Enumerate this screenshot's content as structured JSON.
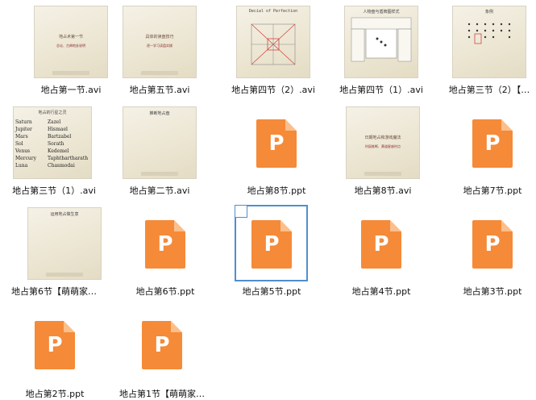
{
  "files": [
    {
      "name": "地占第一节.avi",
      "type": "video",
      "thumb_title": "地占术第一节",
      "thumb_sub": "总论、古典地卦说明"
    },
    {
      "name": "地占第五节.avi",
      "type": "video",
      "thumb_title": "具体的读盘技巧",
      "thumb_sub": "逐一学习读盘实操"
    },
    {
      "name": "地占第四节（2）.avi",
      "type": "video",
      "thumb_title": "Decial of Perfection",
      "thumb_sub": ""
    },
    {
      "name": "地占第四节（1）.avi",
      "type": "video",
      "thumb_title": "人物盘与盾牌图样式",
      "thumb_sub": ""
    },
    {
      "name": "地占第三节（2）【…",
      "type": "video",
      "thumb_title": "象例",
      "thumb_sub": ""
    },
    {
      "name": "地占第三节（1）.avi",
      "type": "video",
      "thumb_title": "地占的行星之灵",
      "thumb_sub": ""
    },
    {
      "name": "地占第二节.avi",
      "type": "video",
      "thumb_title": "推断地占盘",
      "thumb_sub": ""
    },
    {
      "name": "地占第8节.ppt",
      "type": "ppt"
    },
    {
      "name": "地占第8节.avi",
      "type": "video",
      "thumb_title": "日期地占和游戏魔法",
      "thumb_sub": "时辰推断、黄道星座时点"
    },
    {
      "name": "地占第7节.ppt",
      "type": "ppt"
    },
    {
      "name": "地占第6节【萌萌家…",
      "type": "video",
      "thumb_title": "运用地占做生意",
      "thumb_sub": ""
    },
    {
      "name": "地占第6节.ppt",
      "type": "ppt"
    },
    {
      "name": "地占第5节.ppt",
      "type": "ppt",
      "selected": true
    },
    {
      "name": "地占第4节.ppt",
      "type": "ppt"
    },
    {
      "name": "地占第3节.ppt",
      "type": "ppt"
    },
    {
      "name": "地占第2节.ppt",
      "type": "ppt"
    },
    {
      "name": "地占第1节【萌萌家…",
      "type": "ppt"
    }
  ],
  "thumb_texts": {
    "planets_left": [
      "Saturn",
      "Jupiter",
      "Mars",
      "Sol",
      "Venus",
      "Mercury",
      "Luna"
    ],
    "planets_right": [
      "Zazel",
      "Hismael",
      "Bartzabel",
      "Sorath",
      "Kedemel",
      "Taphthartharath",
      "Chasmodai"
    ]
  },
  "ppt_letter": "P",
  "colors": {
    "ppt_orange": "#f58a38",
    "ppt_fold": "#fbbf8c",
    "selection": "#4f8fd0"
  }
}
